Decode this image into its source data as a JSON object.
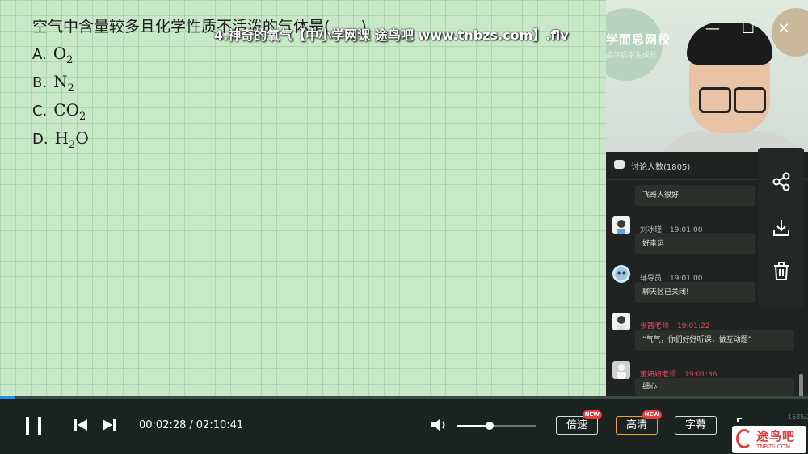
{
  "window": {
    "title": "4.神奇的氧气【中小学网课 途鸟吧 www.tnbzs.com】.flv",
    "controls": {
      "minimize": "—",
      "maximize": "☐",
      "close": "✕"
    }
  },
  "slide": {
    "question": "空气中含量较多且化学性质不活泼的气体是(　　)",
    "options": [
      {
        "key": "A.",
        "formula": "O",
        "sub": "2",
        "tail": ""
      },
      {
        "key": "B.",
        "formula": "N",
        "sub": "2",
        "tail": ""
      },
      {
        "key": "C.",
        "formula": "CO",
        "sub": "2",
        "tail": ""
      },
      {
        "key": "D.",
        "formula": "H",
        "sub": "2",
        "tail": "O"
      }
    ]
  },
  "video": {
    "logo": "学而思网校",
    "logo_sub": "品学质学生成长"
  },
  "chat": {
    "header": "讨论人数(1805)",
    "messages": [
      {
        "name": "",
        "time": "",
        "text": "飞哥人很好",
        "name_color": "#b8b8b8"
      },
      {
        "name": "刘冰瑾",
        "time": "19:01:00",
        "text": "好幸运",
        "name_color": "#b8b8b8"
      },
      {
        "name": "辅导员",
        "time": "19:01:00",
        "text": "聊天区已关闭!",
        "name_color": "#b8b8b8"
      },
      {
        "name": "张茜老师",
        "time": "19:01:22",
        "text": "“气气，你们好好听课，做互动题”",
        "name_color": "#e84a5f"
      },
      {
        "name": "董妍妍老师",
        "time": "19:01:36",
        "text": "细心",
        "name_color": "#e84a5f"
      }
    ]
  },
  "side_actions": {
    "share": "share-icon",
    "download": "download-icon",
    "delete": "trash-icon"
  },
  "player": {
    "progress": 0.018,
    "current_time": "00:02:28",
    "separator": "/",
    "total_time": "02:10:41",
    "volume": 0.42,
    "speed_label": "倍速",
    "quality_label": "高清",
    "subtitle_label": "字幕",
    "new_tag": "NEW",
    "stats_text": "1685/2256"
  },
  "watermark": {
    "brand": "途鸟吧",
    "url": "TNBZS.COM"
  },
  "colors": {
    "slide_bg": "#c8e8c8",
    "accent": "#2a8ee6",
    "teacher_name": "#e84a5f",
    "quality_border": "#f0a030"
  }
}
